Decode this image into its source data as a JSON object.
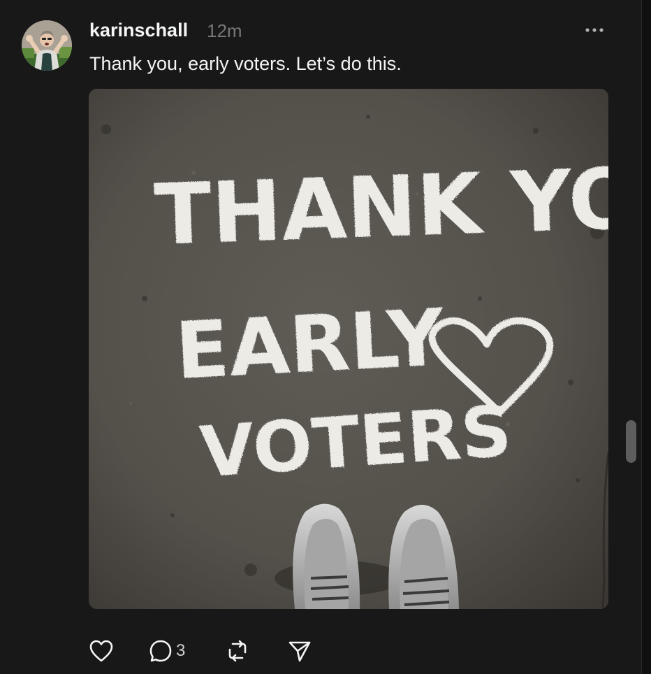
{
  "post": {
    "author": {
      "username": "karinschall",
      "avatar_icon": "profile-photo"
    },
    "time_ago": "12m",
    "caption": "Thank you, early voters. Let’s do this.",
    "more_icon": "ellipsis-icon",
    "image": {
      "chalk_text": [
        "THANK YOU",
        "EARLY",
        "VOTERS"
      ],
      "chalk_symbol": "heart"
    },
    "actions": {
      "like_icon": "heart-icon",
      "reply_icon": "comment-icon",
      "reply_count": "3",
      "repost_icon": "repost-icon",
      "share_icon": "send-icon"
    }
  },
  "colors": {
    "background": "#181818",
    "text_primary": "#f3f5f7",
    "text_secondary": "#777777",
    "icon": "#f3f5f7"
  }
}
